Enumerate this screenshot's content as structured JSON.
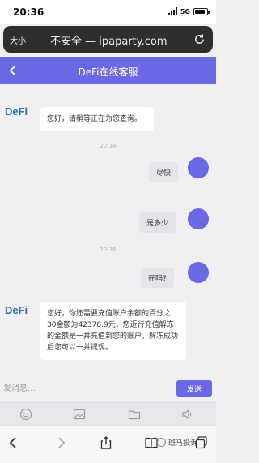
{
  "status_bar": {
    "time": "20:36",
    "network": "5G",
    "battery_level": 0.85
  },
  "browser": {
    "text_size_label": "大小",
    "url": "不安全 — ipaparty.com"
  },
  "chat": {
    "title": "DeFi在线客服",
    "back_icon": "chevron-left-icon"
  },
  "messages": {
    "agent_name": "DeFi",
    "m1": "您好，请稍等正在为您查询。",
    "t1": "20:34",
    "m2": "尽快",
    "m3": "是多少",
    "t2": "20:36",
    "m4": "在吗?",
    "m5": "您好，你还需要充值账户余额的百分之30金额为42378.9元，您近行充值解冻的金额是一并充值到您的账户，解冻成功后您可以一并提现。"
  },
  "composer": {
    "placeholder": "发消息...",
    "send_label": "发送"
  },
  "toolbar": {
    "icons": [
      "emoji-icon",
      "image-icon",
      "folder-icon",
      "voice-icon"
    ]
  },
  "bottom_nav": {
    "watermark": "斑马投诉"
  },
  "colors": {
    "accent": "#6b68e6",
    "brand_logo": "#2e6eb3"
  }
}
